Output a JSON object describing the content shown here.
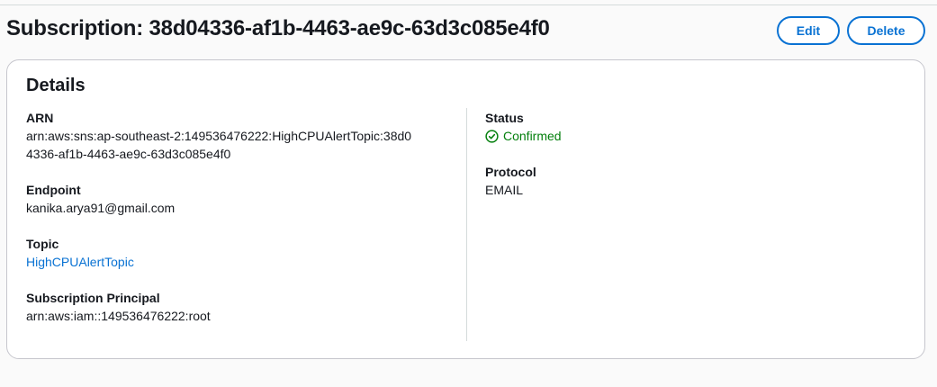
{
  "header": {
    "title": "Subscription: 38d04336-af1b-4463-ae9c-63d3c085e4f0",
    "edit_label": "Edit",
    "delete_label": "Delete"
  },
  "details": {
    "title": "Details",
    "arn": {
      "label": "ARN",
      "value": "arn:aws:sns:ap-southeast-2:149536476222:HighCPUAlertTopic:38d04336-af1b-4463-ae9c-63d3c085e4f0"
    },
    "endpoint": {
      "label": "Endpoint",
      "value": "kanika.arya91@gmail.com"
    },
    "topic": {
      "label": "Topic",
      "value": "HighCPUAlertTopic"
    },
    "subscription_principal": {
      "label": "Subscription Principal",
      "value": "arn:aws:iam::149536476222:root"
    },
    "status": {
      "label": "Status",
      "value": "Confirmed",
      "icon": "check-circle-icon",
      "color": "#037f0c"
    },
    "protocol": {
      "label": "Protocol",
      "value": "EMAIL"
    }
  },
  "colors": {
    "accent": "#0972d3",
    "success": "#037f0c",
    "text": "#16191f",
    "border": "#c6c6cd"
  }
}
